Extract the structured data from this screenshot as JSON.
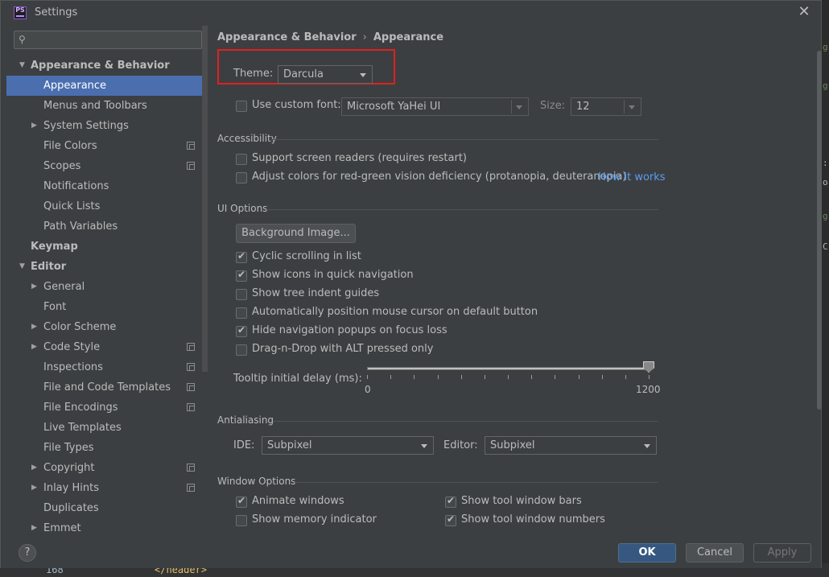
{
  "window": {
    "title": "Settings",
    "app_icon_text": "PS"
  },
  "search": {
    "placeholder": "",
    "value": ""
  },
  "tree": [
    {
      "label": "Appearance & Behavior",
      "level": 0,
      "expanded": true,
      "bold": true,
      "arrow": "▼"
    },
    {
      "label": "Appearance",
      "level": 1,
      "selected": true
    },
    {
      "label": "Menus and Toolbars",
      "level": 1
    },
    {
      "label": "System Settings",
      "level": 1,
      "arrow": "▶"
    },
    {
      "label": "File Colors",
      "level": 1,
      "project": true
    },
    {
      "label": "Scopes",
      "level": 1,
      "project": true
    },
    {
      "label": "Notifications",
      "level": 1
    },
    {
      "label": "Quick Lists",
      "level": 1
    },
    {
      "label": "Path Variables",
      "level": 1
    },
    {
      "label": "Keymap",
      "level": 0,
      "bold": true
    },
    {
      "label": "Editor",
      "level": 0,
      "expanded": true,
      "bold": true,
      "arrow": "▼"
    },
    {
      "label": "General",
      "level": 1,
      "arrow": "▶"
    },
    {
      "label": "Font",
      "level": 1
    },
    {
      "label": "Color Scheme",
      "level": 1,
      "arrow": "▶"
    },
    {
      "label": "Code Style",
      "level": 1,
      "arrow": "▶",
      "project": true
    },
    {
      "label": "Inspections",
      "level": 1,
      "project": true
    },
    {
      "label": "File and Code Templates",
      "level": 1,
      "project": true
    },
    {
      "label": "File Encodings",
      "level": 1,
      "project": true
    },
    {
      "label": "Live Templates",
      "level": 1
    },
    {
      "label": "File Types",
      "level": 1
    },
    {
      "label": "Copyright",
      "level": 1,
      "arrow": "▶",
      "project": true
    },
    {
      "label": "Inlay Hints",
      "level": 1,
      "arrow": "▶",
      "project": true
    },
    {
      "label": "Duplicates",
      "level": 1
    },
    {
      "label": "Emmet",
      "level": 1,
      "arrow": "▶"
    }
  ],
  "breadcrumb": {
    "parent": "Appearance & Behavior",
    "separator": "›",
    "current": "Appearance"
  },
  "theme": {
    "label": "Theme:",
    "value": "Darcula"
  },
  "custom_font": {
    "label": "Use custom font:",
    "checked": false,
    "font_value": "Microsoft YaHei UI",
    "size_label": "Size:",
    "size_value": "12"
  },
  "accessibility": {
    "title": "Accessibility",
    "screen_readers": {
      "label": "Support screen readers (requires restart)",
      "checked": false
    },
    "red_green": {
      "label": "Adjust colors for red-green vision deficiency (protanopia, deuteranopia)",
      "checked": false
    },
    "how_it_works": "How it works"
  },
  "ui_options": {
    "title": "UI Options",
    "background_image_button": "Background Image...",
    "options": [
      {
        "label": "Cyclic scrolling in list",
        "checked": true
      },
      {
        "label": "Show icons in quick navigation",
        "checked": true
      },
      {
        "label": "Show tree indent guides",
        "checked": false
      },
      {
        "label": "Automatically position mouse cursor on default button",
        "checked": false
      },
      {
        "label": "Hide navigation popups on focus loss",
        "checked": true
      },
      {
        "label": "Drag-n-Drop with ALT pressed only",
        "checked": false
      }
    ],
    "tooltip_label": "Tooltip initial delay (ms):",
    "tooltip_min": "0",
    "tooltip_max": "1200",
    "tooltip_value_fraction": 1.0
  },
  "antialiasing": {
    "title": "Antialiasing",
    "ide_label": "IDE:",
    "ide_value": "Subpixel",
    "editor_label": "Editor:",
    "editor_value": "Subpixel"
  },
  "window_options": {
    "title": "Window Options",
    "animate_windows": {
      "label": "Animate windows",
      "checked": true
    },
    "show_memory": {
      "label": "Show memory indicator",
      "checked": false
    },
    "show_tool_bars": {
      "label": "Show tool window bars",
      "checked": true
    },
    "show_tool_numbers": {
      "label": "Show tool window numbers",
      "checked": true
    }
  },
  "buttons": {
    "help": "?",
    "ok": "OK",
    "cancel": "Cancel",
    "apply": "Apply"
  },
  "background": {
    "line_number": "168",
    "code": "</header>"
  },
  "colors": {
    "accent_selected": "#4b6eaf",
    "highlight_border": "#e02020",
    "link": "#589df6"
  }
}
